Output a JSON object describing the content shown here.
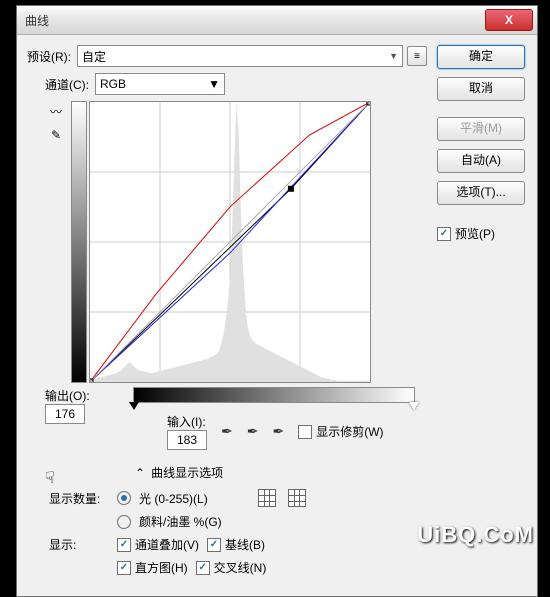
{
  "window": {
    "title": "曲线"
  },
  "preset": {
    "label": "预设(R):",
    "value": "自定"
  },
  "channel": {
    "label": "通道(C):",
    "value": "RGB"
  },
  "output": {
    "label": "输出(O):",
    "value": "176"
  },
  "input": {
    "label": "输入(I):",
    "value": "183"
  },
  "show_clip": {
    "label": "显示修剪(W)",
    "checked": false
  },
  "expand": {
    "label": "曲线显示选项"
  },
  "amount": {
    "label": "显示数量:",
    "light": {
      "label": "光 (0-255)(L)",
      "checked": true
    },
    "pigment": {
      "label": "颜料/油墨 %(G)",
      "checked": false
    }
  },
  "show": {
    "label": "显示:",
    "overlay": {
      "label": "通道叠加(V)",
      "checked": true
    },
    "baseline": {
      "label": "基线(B)",
      "checked": true
    },
    "histogram": {
      "label": "直方图(H)",
      "checked": true
    },
    "intersection": {
      "label": "交叉线(N)",
      "checked": true
    }
  },
  "buttons": {
    "ok": "确定",
    "cancel": "取消",
    "smooth": "平滑(M)",
    "auto": "自动(A)",
    "options": "选项(T)..."
  },
  "preview": {
    "label": "预览(P)",
    "checked": true
  },
  "watermark": "UiBQ.CoM",
  "chart_data": {
    "type": "line",
    "xlim": [
      0,
      255
    ],
    "ylim": [
      0,
      255
    ],
    "grid": 4,
    "series": [
      {
        "name": "rgb-curve",
        "color": "#000",
        "points": [
          [
            0,
            0
          ],
          [
            183,
            176
          ],
          [
            255,
            255
          ]
        ]
      },
      {
        "name": "red-channel",
        "color": "#d00",
        "points": [
          [
            0,
            0
          ],
          [
            60,
            80
          ],
          [
            128,
            160
          ],
          [
            200,
            225
          ],
          [
            255,
            255
          ]
        ]
      },
      {
        "name": "blue-channel",
        "color": "#22d",
        "points": [
          [
            0,
            0
          ],
          [
            128,
            118
          ],
          [
            255,
            255
          ]
        ]
      },
      {
        "name": "baseline",
        "color": "#aaa",
        "points": [
          [
            0,
            0
          ],
          [
            255,
            255
          ]
        ]
      }
    ],
    "histogram": [
      2,
      2,
      3,
      3,
      4,
      4,
      5,
      5,
      6,
      6,
      7,
      7,
      8,
      9,
      10,
      12,
      14,
      16,
      18,
      16,
      14,
      12,
      11,
      10,
      10,
      9,
      9,
      8,
      8,
      8,
      9,
      9,
      10,
      10,
      11,
      11,
      12,
      12,
      13,
      13,
      14,
      14,
      15,
      15,
      16,
      16,
      17,
      17,
      18,
      18,
      19,
      19,
      20,
      20,
      21,
      22,
      23,
      24,
      25,
      28,
      34,
      42,
      55,
      70,
      95,
      140,
      200,
      250,
      220,
      150,
      100,
      70,
      50,
      42,
      38,
      36,
      34,
      33,
      32,
      31,
      30,
      29,
      28,
      27,
      26,
      25,
      24,
      23,
      22,
      21,
      20,
      19,
      18,
      17,
      16,
      15,
      14,
      13,
      12,
      11,
      10,
      9,
      8,
      7,
      6,
      5,
      4,
      4,
      3,
      3,
      2,
      2,
      2,
      1,
      1,
      1,
      1,
      1,
      1,
      1,
      1,
      1,
      1,
      1,
      1,
      1,
      1,
      1
    ]
  }
}
